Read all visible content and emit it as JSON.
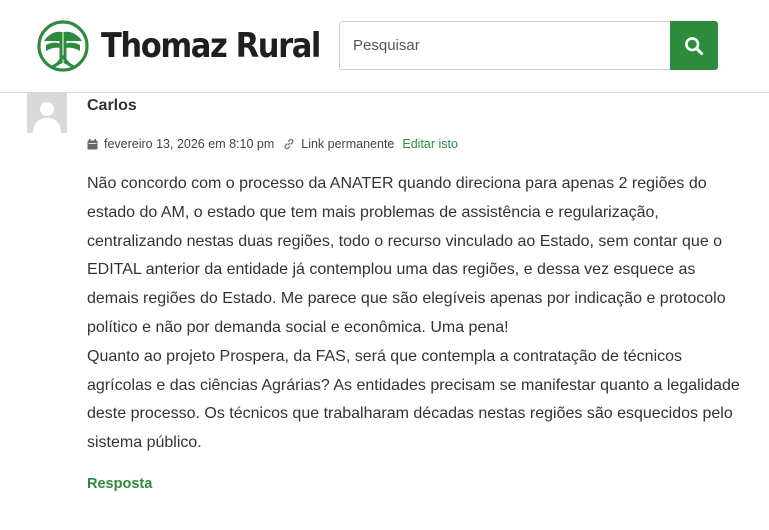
{
  "header": {
    "site_name": "Thomaz Rural",
    "search": {
      "placeholder": "Pesquisar",
      "value": ""
    },
    "search_button_icon": "search-icon",
    "brand_color": "#2e8b3e"
  },
  "comment": {
    "author": "Carlos",
    "avatar_icon": "default-avatar-icon",
    "date": "fevereiro 13, 2026 em 8:10 pm",
    "permalink_label": "Link permanente",
    "edit_label": "Editar isto",
    "paragraphs": [
      "Não concordo com o processo da ANATER quando direciona para apenas 2 regiões do estado do AM, o estado que tem mais problemas de assistência e regularização, centralizando nestas duas regiões, todo o recurso vinculado ao Estado, sem contar que o EDITAL anterior da entidade já contemplou uma das regiões, e dessa vez esquece as demais regiões do Estado. Me parece que são elegíveis apenas por indicação e protocolo político e não por demanda social e econômica. Uma pena!",
      "Quanto ao projeto Prospera, da FAS, será que contempla a contratação de técnicos agrícolas e das ciências Agrárias? As entidades precisam se manifestar quanto a legalidade deste processo. Os técnicos que trabalharam décadas nestas regiões são esquecidos pelo sistema público."
    ],
    "reply_label": "Resposta"
  }
}
